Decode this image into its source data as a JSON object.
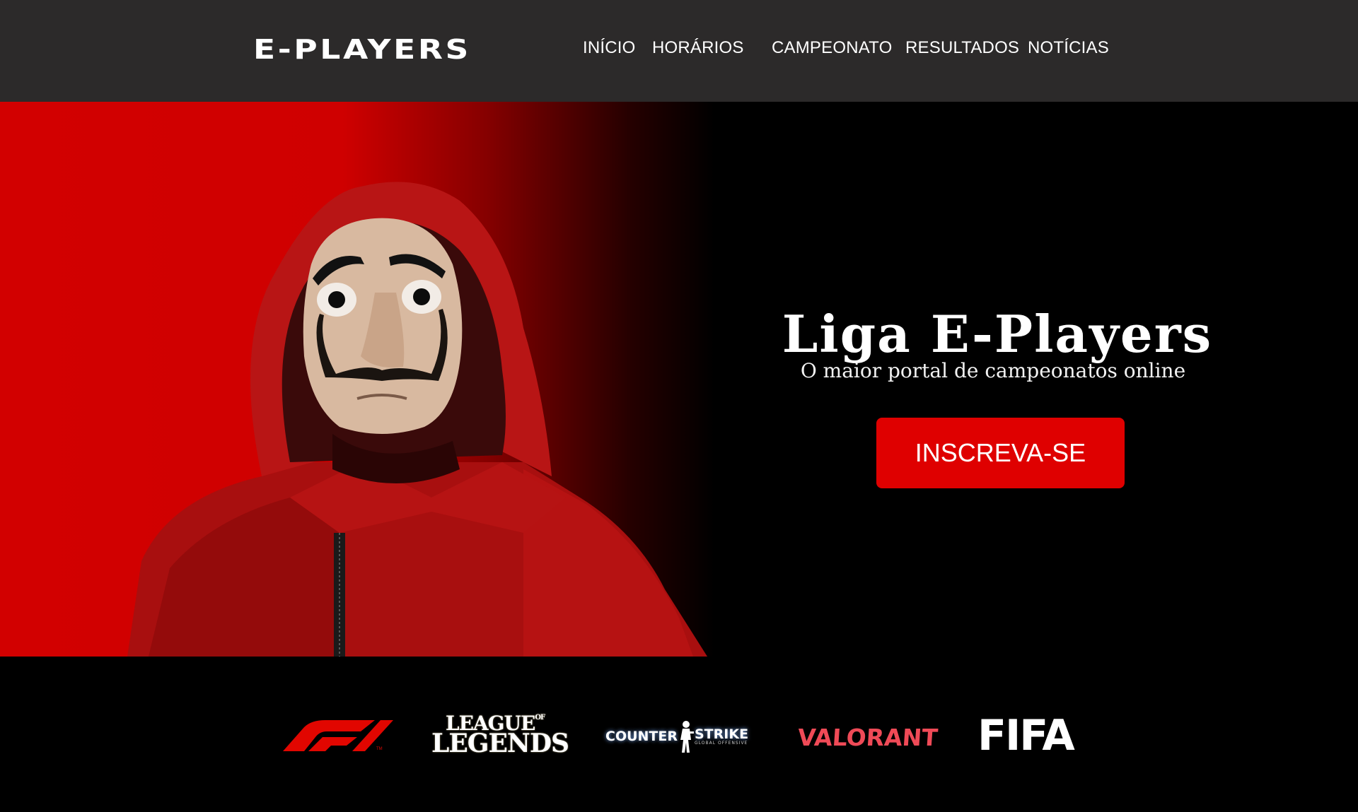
{
  "header": {
    "logo_text": "E-PLAYERS",
    "nav": [
      {
        "label": "INÍCIO"
      },
      {
        "label": "HORÁRIOS"
      },
      {
        "label": "CAMPEONATO"
      },
      {
        "label": "RESULTADOS"
      },
      {
        "label": "NOTÍCIAS"
      }
    ]
  },
  "hero": {
    "title": "Liga E-Players",
    "subtitle": "O maior portal de campeonatos online",
    "cta_label": "INSCREVA-SE",
    "image": "money-heist-dali-mask-figure"
  },
  "games": {
    "logos": [
      {
        "name": "F1",
        "text": "F1"
      },
      {
        "name": "League of Legends",
        "text_line1": "LEAGUE",
        "text_of": "OF",
        "text_line2": "LEGENDS"
      },
      {
        "name": "Counter-Strike",
        "text_left": "COUNTER",
        "text_right": "STRIKE",
        "subtitle": "GLOBAL OFFENSIVE"
      },
      {
        "name": "Valorant",
        "text": "VALORANT"
      },
      {
        "name": "FIFA",
        "text": "FIFA"
      }
    ]
  },
  "colors": {
    "navbar_bg": "#2c2a2a",
    "accent_red": "#df0000",
    "hero_red": "#d20000",
    "valorant_red": "#ef4a57"
  }
}
